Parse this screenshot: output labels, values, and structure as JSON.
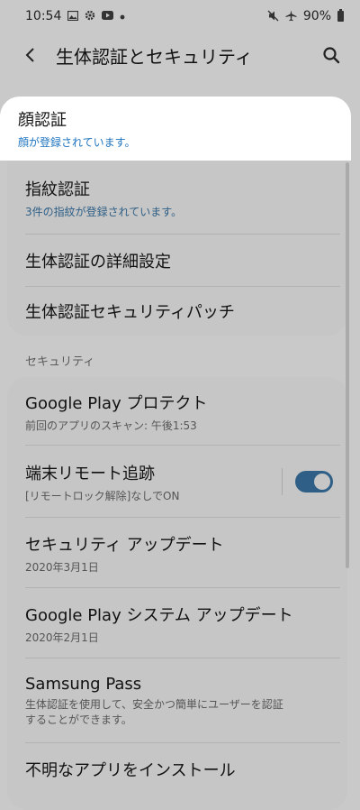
{
  "status_bar": {
    "time": "10:54",
    "battery": "90%",
    "left_icons": [
      "gallery-icon",
      "gear-icon",
      "youtube-icon",
      "dot-icon"
    ],
    "right_icons": [
      "mute-icon",
      "airplane-mode-icon",
      "battery-icon"
    ]
  },
  "appbar": {
    "title": "生体認証とセキュリティ"
  },
  "biometrics": {
    "items": [
      {
        "label": "顔認証",
        "sub": "顔が登録されています。"
      },
      {
        "label": "指紋認証",
        "sub": "3件の指紋が登録されています。"
      },
      {
        "label": "生体認証の詳細設定"
      },
      {
        "label": "生体認証セキュリティパッチ"
      }
    ]
  },
  "security": {
    "header": "セキュリティ",
    "items": [
      {
        "label": "Google Play プロテクト",
        "sub": "前回のアプリのスキャン: 午後1:53"
      },
      {
        "label": "端末リモート追跡",
        "sub": "[リモートロック解除]なしでON",
        "toggle_on": true
      },
      {
        "label": "セキュリティ アップデート",
        "sub": "2020年3月1日"
      },
      {
        "label": "Google Play システム アップデート",
        "sub": "2020年2月1日"
      },
      {
        "label": "Samsung Pass",
        "sub": "生体認証を使用して、安全かつ簡単にユーザーを認証\nすることができます。"
      },
      {
        "label": "不明なアプリをインストール"
      }
    ]
  },
  "colors": {
    "accent_blue": "#1e73be",
    "toggle_on": "#2f5f86",
    "dim_background": "#c9c9c9",
    "highlight_background": "#ffffff"
  }
}
